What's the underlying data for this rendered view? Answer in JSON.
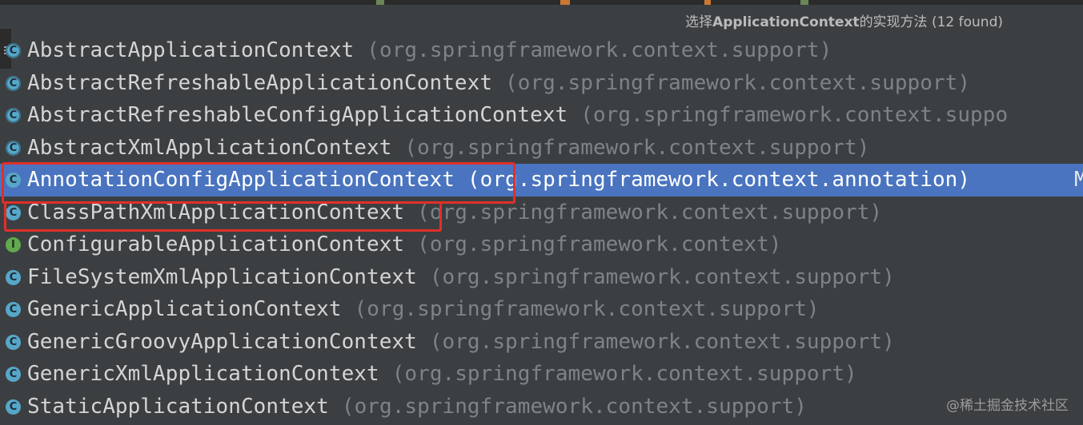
{
  "popup": {
    "title_prefix": "选择",
    "title_bold": "ApplicationContext",
    "title_suffix": "的实现方法 (12 found)"
  },
  "items": [
    {
      "name": "AbstractApplicationContext",
      "package": "(org.springframework.context.support)",
      "kind": "abstract-class-icon"
    },
    {
      "name": "AbstractRefreshableApplicationContext",
      "package": "(org.springframework.context.support)",
      "kind": "abstract-class-icon"
    },
    {
      "name": "AbstractRefreshableConfigApplicationContext",
      "package": "(org.springframework.context.suppo",
      "kind": "abstract-class-icon"
    },
    {
      "name": "AbstractXmlApplicationContext",
      "package": "(org.springframework.context.support)",
      "kind": "abstract-class-icon"
    },
    {
      "name": "AnnotationConfigApplicationContext",
      "package": "(org.springframework.context.annotation)",
      "kind": "class-icon",
      "extra": "M"
    },
    {
      "name": "ClassPathXmlApplicationContext",
      "package": "(org.springframework.context.support)",
      "kind": "class-icon"
    },
    {
      "name": "ConfigurableApplicationContext",
      "package": "(org.springframework.context)",
      "kind": "interface-icon"
    },
    {
      "name": "FileSystemXmlApplicationContext",
      "package": "(org.springframework.context.support)",
      "kind": "class-icon"
    },
    {
      "name": "GenericApplicationContext",
      "package": "(org.springframework.context.support)",
      "kind": "class-icon"
    },
    {
      "name": "GenericGroovyApplicationContext",
      "package": "(org.springframework.context.support)",
      "kind": "class-icon"
    },
    {
      "name": "GenericXmlApplicationContext",
      "package": "(org.springframework.context.support)",
      "kind": "class-icon"
    },
    {
      "name": "StaticApplicationContext",
      "package": "(org.springframework.context.support)",
      "kind": "class-icon"
    }
  ],
  "icon_letters": {
    "class": "C",
    "interface": "I"
  },
  "selected_index": 4,
  "watermark": "@稀土掘金技术社区",
  "colors": {
    "selection": "#4a74bf",
    "highlight_border": "#e0302a"
  }
}
